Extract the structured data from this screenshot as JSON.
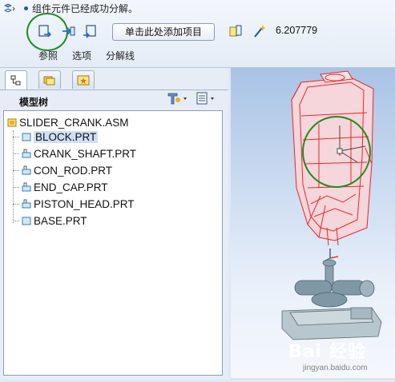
{
  "dashboard": {
    "message": "组件元件已经成功分解。",
    "add_item_label": "单击此处添加项目",
    "value": "6.207779",
    "tabs": [
      "参照",
      "选项",
      "分解线"
    ]
  },
  "panel": {
    "tree_title": "模型树",
    "root": "SLIDER_CRANK.ASM",
    "items": [
      {
        "label": "BLOCK.PRT",
        "selected": true
      },
      {
        "label": "CRANK_SHAFT.PRT",
        "selected": false
      },
      {
        "label": "CON_ROD.PRT",
        "selected": false
      },
      {
        "label": "END_CAP.PRT",
        "selected": false
      },
      {
        "label": "PISTON_HEAD.PRT",
        "selected": false
      },
      {
        "label": "BASE.PRT",
        "selected": false
      }
    ]
  },
  "colors": {
    "highlight_red": "#e8262b",
    "annotation_green": "#1f8a24",
    "selection_bg": "#cfe0f6"
  },
  "watermark": {
    "brand": "Bai 经验",
    "url": "jingyan.baidu.com"
  }
}
